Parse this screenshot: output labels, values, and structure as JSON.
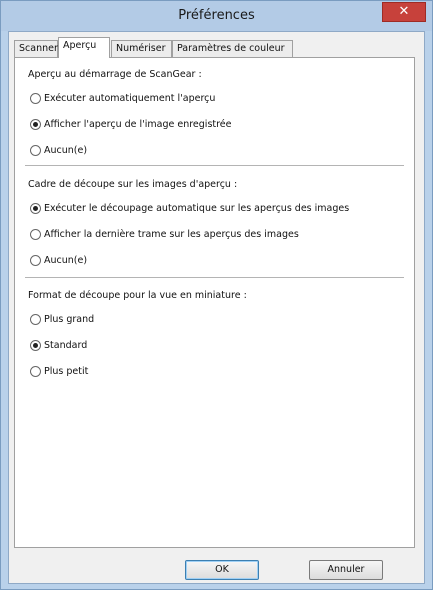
{
  "window": {
    "title": "Préférences",
    "close_symbol": "✕"
  },
  "tabs": [
    {
      "label": "Scanner",
      "active": false
    },
    {
      "label": "Aperçu",
      "active": true
    },
    {
      "label": "Numériser",
      "active": false
    },
    {
      "label": "Paramètres de couleur",
      "active": false
    }
  ],
  "groups": [
    {
      "title": "Aperçu au démarrage de ScanGear :",
      "options": [
        {
          "label": "Exécuter automatiquement l'aperçu",
          "selected": false
        },
        {
          "label": "Afficher l'aperçu de l'image enregistrée",
          "selected": true
        },
        {
          "label": "Aucun(e)",
          "selected": false
        }
      ]
    },
    {
      "title": "Cadre de découpe sur les images d'aperçu :",
      "options": [
        {
          "label": "Exécuter le découpage automatique sur les aperçus des images",
          "selected": true
        },
        {
          "label": "Afficher la dernière trame sur les aperçus des images",
          "selected": false
        },
        {
          "label": "Aucun(e)",
          "selected": false
        }
      ]
    },
    {
      "title": "Format de découpe pour la vue en miniature :",
      "options": [
        {
          "label": "Plus grand",
          "selected": false
        },
        {
          "label": "Standard",
          "selected": true
        },
        {
          "label": "Plus petit",
          "selected": false
        }
      ]
    }
  ],
  "buttons": {
    "ok": "OK",
    "cancel": "Annuler"
  }
}
